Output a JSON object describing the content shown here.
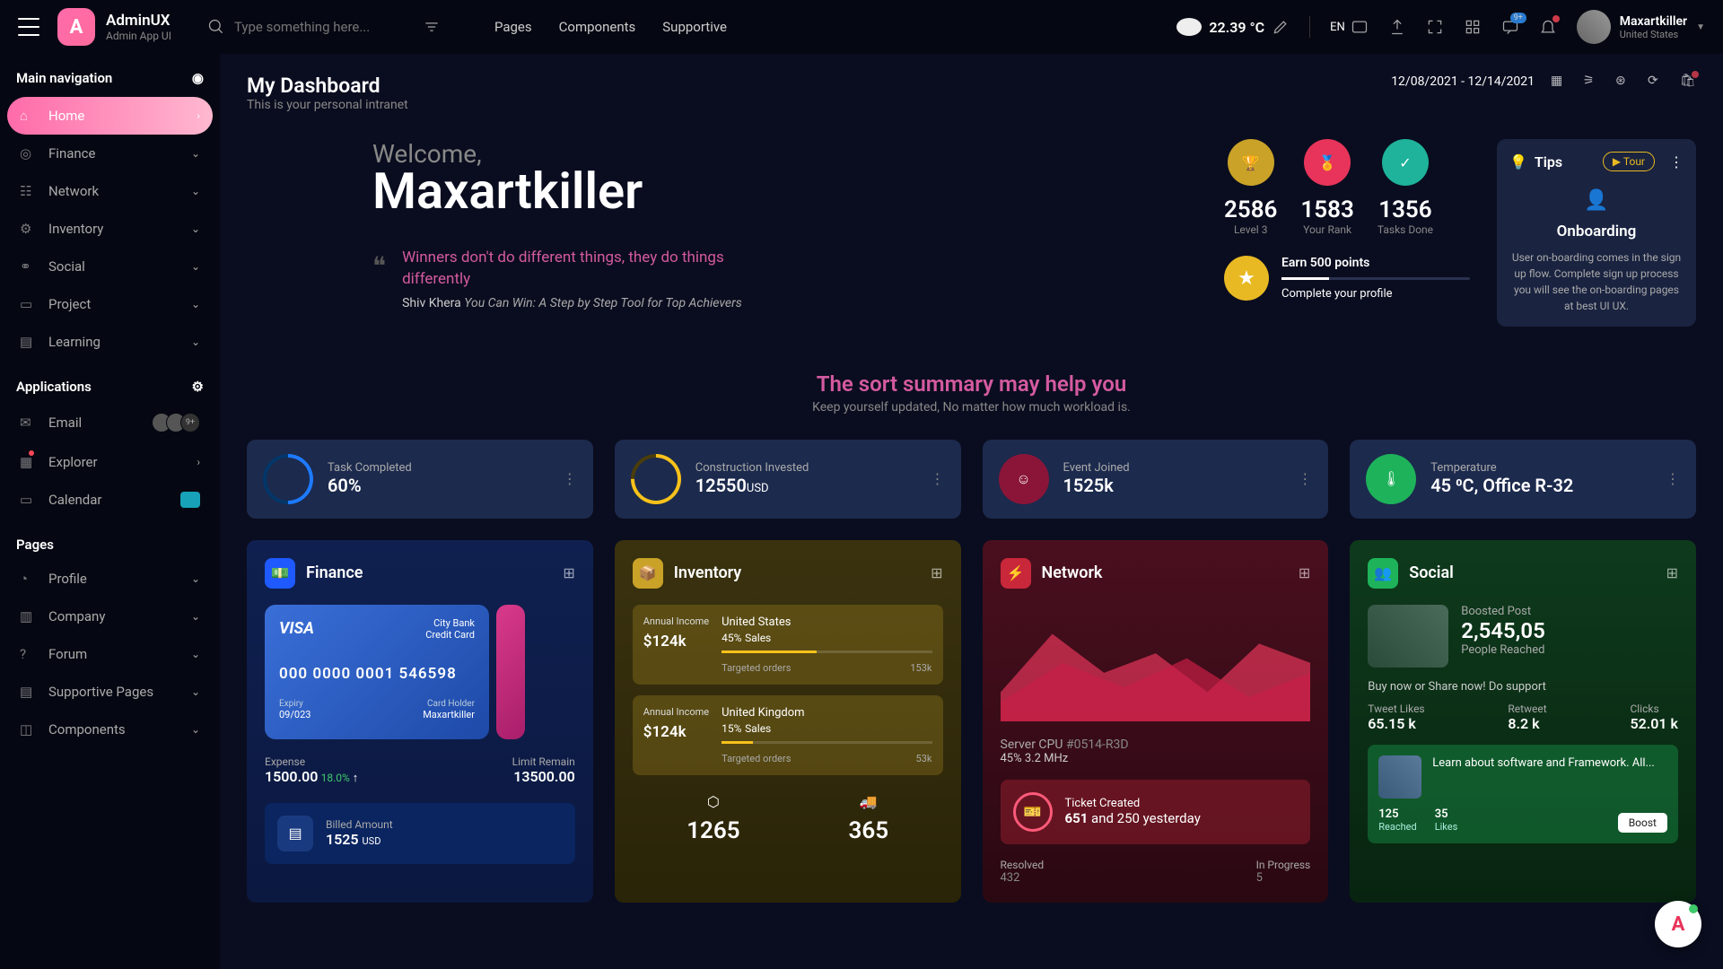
{
  "brand": {
    "title": "AdminUX",
    "subtitle": "Admin App UI",
    "logo_letter": "A"
  },
  "search": {
    "placeholder": "Type something here..."
  },
  "top_links": [
    "Pages",
    "Components",
    "Supportive"
  ],
  "weather": {
    "temp": "22.39 °C"
  },
  "lang": "EN",
  "user": {
    "name": "Maxartkiller",
    "location": "United States"
  },
  "sidebar": {
    "main_title": "Main navigation",
    "items": [
      "Home",
      "Finance",
      "Network",
      "Inventory",
      "Social",
      "Project",
      "Learning"
    ],
    "apps_title": "Applications",
    "apps": [
      "Email",
      "Explorer",
      "Calendar"
    ],
    "pages_title": "Pages",
    "pages": [
      "Profile",
      "Company",
      "Forum",
      "Supportive Pages",
      "Components"
    ],
    "email_count": "9+"
  },
  "page": {
    "title": "My Dashboard",
    "subtitle": "This is your personal intranet",
    "daterange": "12/08/2021 - 12/14/2021"
  },
  "welcome": {
    "greeting": "Welcome,",
    "name": "Maxartkiller",
    "quote": "Winners don't do different things, they do things differently",
    "author": "Shiv Khera",
    "book": "You Can Win: A Step by Step Tool for Top Achievers"
  },
  "stats": [
    {
      "value": "2586",
      "label": "Level 3"
    },
    {
      "value": "1583",
      "label": "Your Rank"
    },
    {
      "value": "1356",
      "label": "Tasks Done"
    }
  ],
  "earn": {
    "title": "Earn 500 points",
    "subtitle": "Complete your profile"
  },
  "tips": {
    "title": "Tips",
    "tour": "Tour",
    "heading": "Onboarding",
    "body": "User on-boarding comes in the sign up flow. Complete sign up process you will see the on-boarding pages at best UI UX."
  },
  "summary": {
    "pre": "The sort ",
    "highlight": "summary",
    "post": " may help you",
    "sub": "Keep yourself updated, No matter how much workload is."
  },
  "metrics": [
    {
      "label": "Task Completed",
      "value": "60%"
    },
    {
      "label": "Construction Invested",
      "value": "12550",
      "unit": "USD"
    },
    {
      "label": "Event Joined",
      "value": "1525k"
    },
    {
      "label": "Temperature",
      "value": "45 ⁰C, Office R-32"
    }
  ],
  "finance": {
    "title": "Finance",
    "card": {
      "brand": "VISA",
      "bank": "City Bank",
      "type": "Credit Card",
      "number": "000 0000 0001 546598",
      "expiry_label": "Expiry",
      "expiry": "09/023",
      "holder_label": "Card Holder",
      "holder": "Maxartkiller"
    },
    "expense_label": "Expense",
    "expense": "1500.00",
    "expense_pct": "18.0% ",
    "limit_label": "Limit Remain",
    "limit": "13500.00",
    "billed_label": "Billed Amount",
    "billed": "1525",
    "billed_unit": "USD"
  },
  "inventory": {
    "title": "Inventory",
    "blocks": [
      {
        "annual": "Annual Income",
        "amt": "$124k",
        "country": "United States",
        "pct": "45%",
        "sales": "Sales",
        "target_label": "Targeted orders",
        "target": "153k"
      },
      {
        "annual": "Annual Income",
        "amt": "$124k",
        "country": "United Kingdom",
        "pct": "15%",
        "sales": "Sales",
        "target_label": "Targeted orders",
        "target": "53k"
      }
    ],
    "bottom": [
      {
        "val": "1265"
      },
      {
        "val": "365"
      }
    ]
  },
  "network": {
    "title": "Network",
    "server_label": "Server CPU",
    "server_id": "#0514-R3D",
    "mhz": "45% 3.2 MHz",
    "ticket_label": "Ticket Created",
    "ticket_val": "651",
    "ticket_rest": " and 250 yesterday",
    "resolved_label": "Resolved",
    "resolved": "432",
    "progress_label": "In Progress",
    "progress": "5"
  },
  "social": {
    "title": "Social",
    "boosted": "Boosted Post",
    "count": "2,545,05",
    "reached": "People Reached",
    "buy": "Buy now or Share now! Do support",
    "stats": [
      {
        "label": "Tweet Likes",
        "val": "65.15 k"
      },
      {
        "label": "Retweet",
        "val": "8.2 k"
      },
      {
        "label": "Clicks",
        "val": "52.01 k"
      }
    ],
    "learn": "Learn about software and Framework. All...",
    "learn_stats": [
      {
        "val": "125",
        "label": "Reached"
      },
      {
        "val": "35",
        "label": "Likes"
      }
    ],
    "boost": "Boost"
  }
}
